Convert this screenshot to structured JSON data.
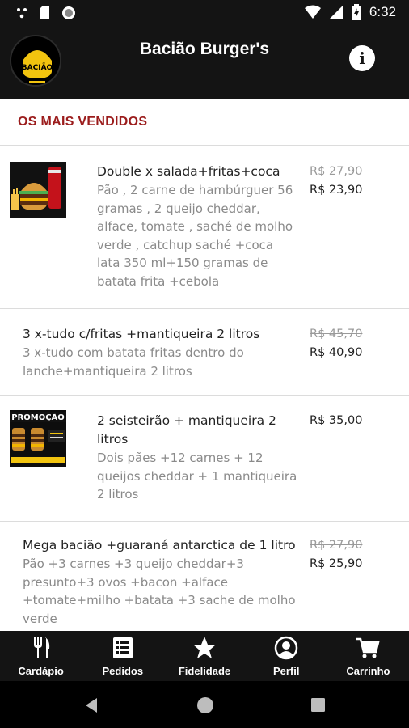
{
  "status_bar": {
    "time": "6:32"
  },
  "app_bar": {
    "title": "Bacião Burger's",
    "info_icon": "info-icon",
    "logo_text": "BACIÃO"
  },
  "section": {
    "title": "OS MAIS VENDIDOS"
  },
  "products": [
    {
      "name": "Double x salada+fritas+coca",
      "description": "Pão , 2 carne de hambúrguer 56 gramas , 2 queijo cheddar, alface,  tomate , saché de molho verde , catchup saché +coca lata 350 ml+150 gramas de batata frita +cebola",
      "old_price": "R$ 27,90",
      "price": "R$ 23,90"
    },
    {
      "name": "3 x-tudo c/fritas +mantiqueira 2 litros",
      "description": "3 x-tudo com batata fritas dentro do lanche+mantiqueira 2 litros",
      "old_price": "R$ 45,70",
      "price": "R$ 40,90"
    },
    {
      "name": "2 seisteirão + mantiqueira 2 litros",
      "description": "Dois pães +12 carnes + 12 queijos cheddar + 1 mantiqueira 2 litros",
      "old_price": "",
      "price": "R$ 35,00",
      "thumb_text": "PROMOÇÃO"
    },
    {
      "name": "Mega bacião +guaraná antarctica de 1 litro",
      "description": "Pão +3 carnes +3 queijo cheddar+3 presunto+3 ovos +bacon +alface +tomate+milho +batata +3 sache de molho verde",
      "old_price": "R$ 27,90",
      "price": "R$ 25,90"
    }
  ],
  "bottom_nav": [
    {
      "label": "Cardápio",
      "icon": "cutlery-icon"
    },
    {
      "label": "Pedidos",
      "icon": "list-icon"
    },
    {
      "label": "Fidelidade",
      "icon": "star-icon"
    },
    {
      "label": "Perfil",
      "icon": "user-icon"
    },
    {
      "label": "Carrinho",
      "icon": "cart-icon"
    }
  ],
  "colors": {
    "bar_bg": "#141414",
    "section_title": "#9b1c1c"
  }
}
